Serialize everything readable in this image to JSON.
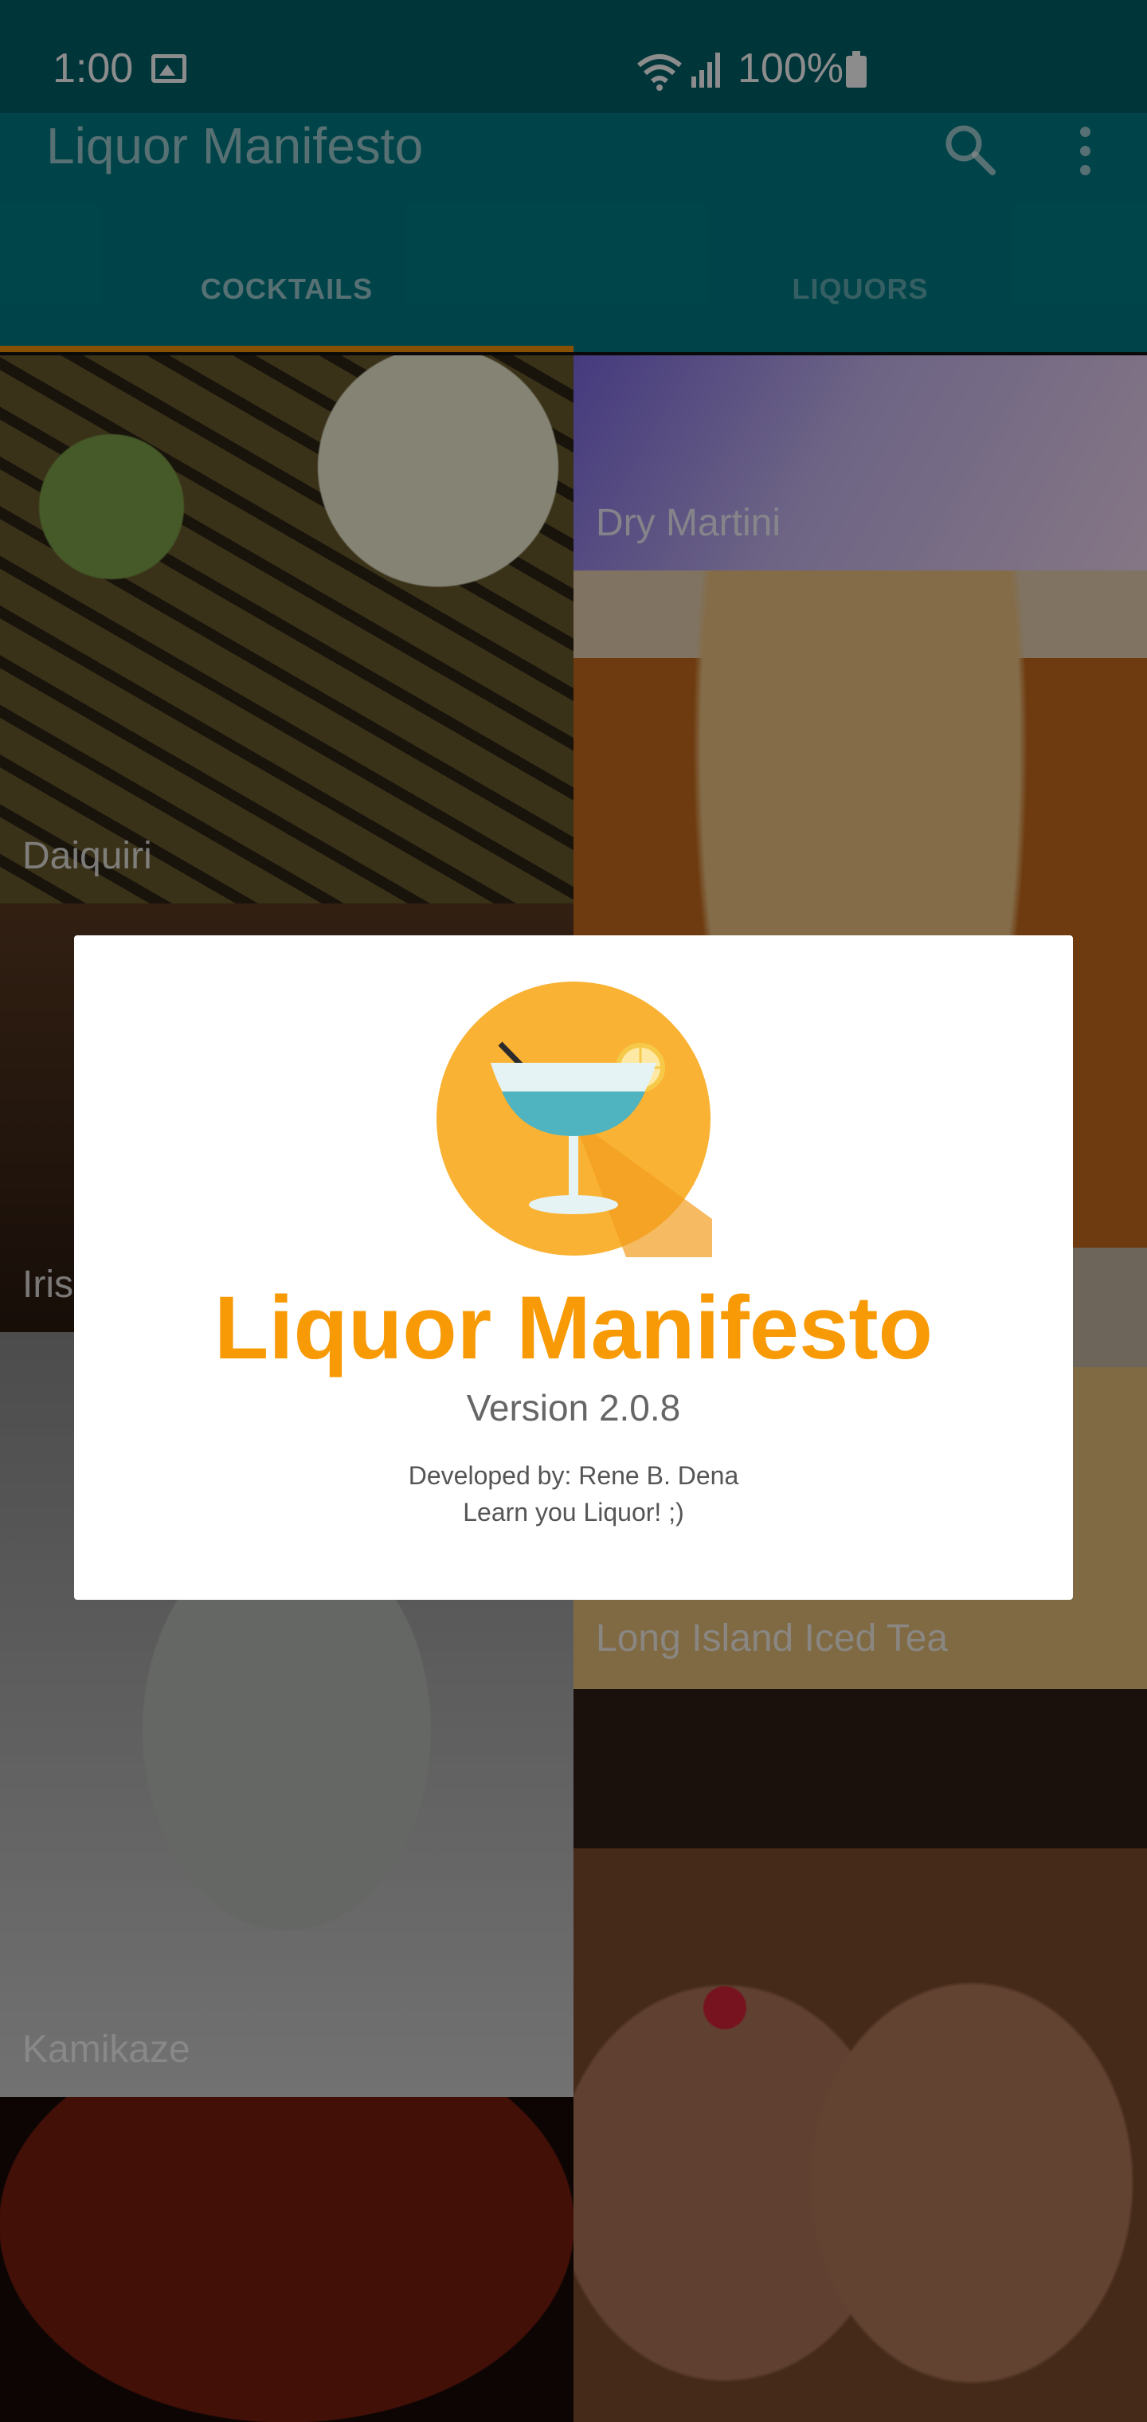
{
  "status_bar": {
    "time": "1:00",
    "battery": "100%"
  },
  "app_bar": {
    "title": "Liquor Manifesto",
    "tabs": [
      {
        "label": "COCKTAILS",
        "selected": true
      },
      {
        "label": "LIQUORS",
        "selected": false
      }
    ]
  },
  "cocktails": [
    {
      "name": "Daiquiri"
    },
    {
      "name": "Dry Martini"
    },
    {
      "name": "Iris"
    },
    {
      "name": "Long Island Iced Tea"
    },
    {
      "name": "Kamikaze"
    }
  ],
  "about_dialog": {
    "title": "Liquor Manifesto",
    "version": "Version 2.0.8",
    "developer": "Developed by: Rene B. Dena",
    "tagline": "Learn you Liquor! ;)"
  },
  "colors": {
    "primary": "#007d86",
    "accent": "#f59200"
  }
}
